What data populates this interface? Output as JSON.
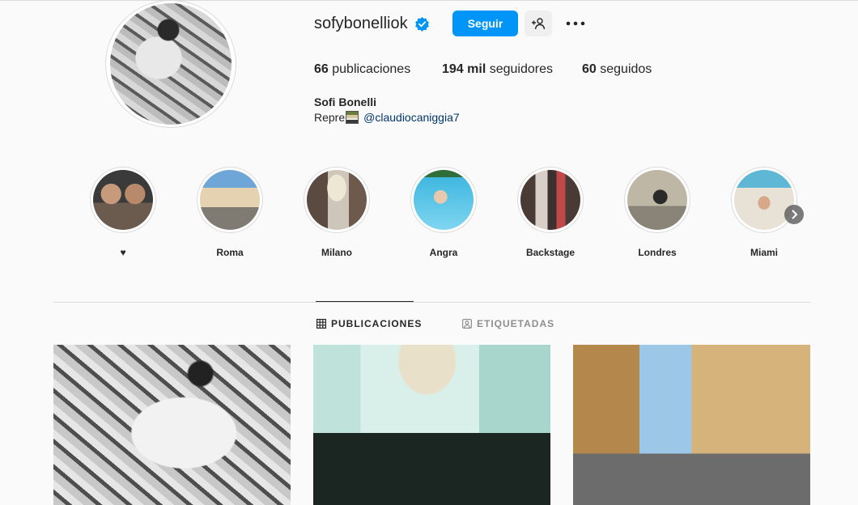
{
  "profile": {
    "username": "sofybonelliok",
    "follow_label": "Seguir",
    "stats": {
      "posts_count": "66",
      "posts_label": "publicaciones",
      "followers_count": "194 mil",
      "followers_label": "seguidores",
      "following_count": "60",
      "following_label": "seguidos"
    },
    "full_name": "Sofi Bonelli",
    "bio_prefix": "Repre",
    "bio_link": "@claudiocaniggia7",
    "verified_color": "#0095f6"
  },
  "highlights": [
    {
      "label": "♥"
    },
    {
      "label": "Roma"
    },
    {
      "label": "Milano"
    },
    {
      "label": "Angra"
    },
    {
      "label": "Backstage"
    },
    {
      "label": "Londres"
    },
    {
      "label": "Miami"
    }
  ],
  "tabs": {
    "posts": "PUBLICACIONES",
    "tagged": "ETIQUETADAS"
  },
  "icons": {
    "verified": "verified-badge-icon",
    "suggest": "add-person-icon",
    "more": "more-dots-icon",
    "grid": "grid-icon",
    "tagged": "tagged-icon",
    "next": "chevron-right-icon"
  },
  "colors": {
    "accent": "#0095f6",
    "link": "#00376b",
    "muted": "#8e8e8e"
  }
}
